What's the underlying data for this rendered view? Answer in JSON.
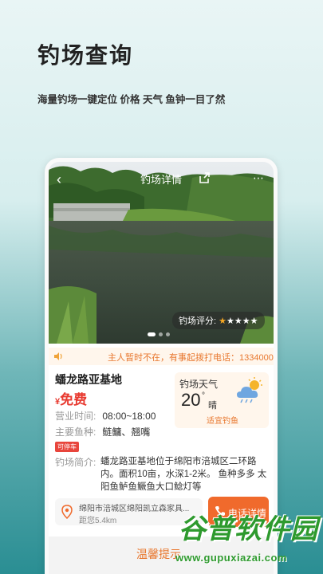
{
  "hero": {
    "title": "钓场查询",
    "subtitle": "海量钓场一键定位   价格 天气 鱼钟一目了然"
  },
  "detail": {
    "topbar_title": "钓场详情",
    "rating_label": "钓场评分:",
    "rating_value": 1,
    "rating_max": 5,
    "carousel_pages": 3,
    "carousel_active": 1,
    "notice": "主人暂时不在，有事起拨打电话：1334000",
    "spot_name": "蟠龙路亚基地",
    "price_symbol": "¥",
    "price": "免费",
    "hours_label": "营业时间:",
    "hours_value": "08:00~18:00",
    "fish_label": "主要鱼种:",
    "fish_value": "鲢鳙、翘嘴",
    "parking_tag": "可停车",
    "intro_label": "钓场简介:",
    "intro_text": "蟠龙路亚基地位于绵阳市涪城区二环路内。面积10亩，水深1-2米。 鱼种多多 太阳鱼鲈鱼鳜鱼大口鲶灯等",
    "weather": {
      "title": "钓场天气",
      "temp": "20",
      "deg": "°",
      "condition": "晴",
      "suitability": "适宜钓鱼"
    },
    "address": "绵阳市涪城区绵阳凯立森家具...",
    "distance": "距您5.4km",
    "phone_button": "电话详情",
    "tips": "温馨提示"
  },
  "watermark": {
    "brand": "谷普软件园",
    "url": "www.gupuxiazai.com"
  },
  "colors": {
    "accent": "#f06a2c",
    "price": "#e83a30",
    "notice": "#e8772e",
    "watermark": "#2e9a2e"
  }
}
